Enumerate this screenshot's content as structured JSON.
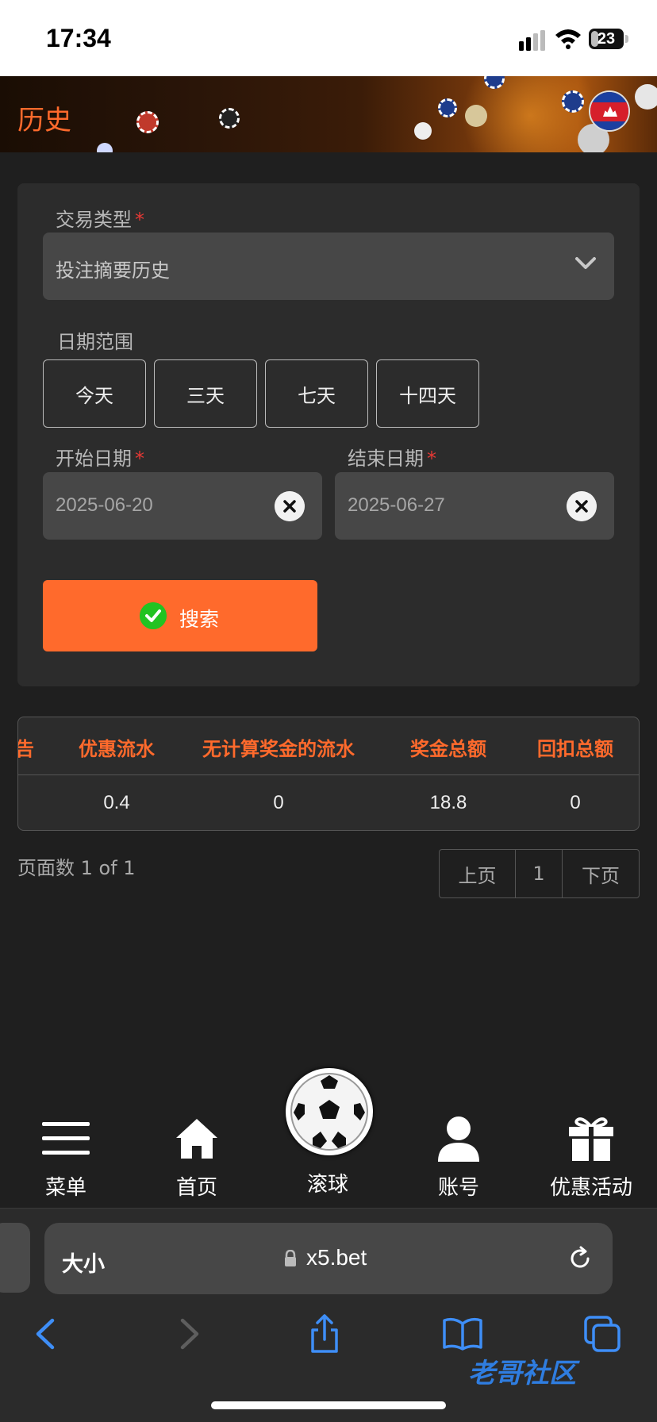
{
  "status_bar": {
    "time": "17:34",
    "battery": "23",
    "battery_level": 0.23
  },
  "header": {
    "title": "历史"
  },
  "form": {
    "transaction_type_label": "交易类型",
    "required_mark": "*",
    "transaction_type_value": "投注摘要历史",
    "date_range_label": "日期范围",
    "range_buttons": [
      "今天",
      "三天",
      "七天",
      "十四天"
    ],
    "start_date_label": "开始日期",
    "start_date_value": "2025-06-20",
    "end_date_label": "结束日期",
    "end_date_value": "2025-06-27",
    "search_label": "搜索"
  },
  "table": {
    "columns": [
      "告",
      "优惠流水",
      "无计算奖金的流水",
      "奖金总额",
      "回扣总额"
    ],
    "rows": [
      [
        "",
        "0.4",
        "0",
        "18.8",
        "0"
      ]
    ]
  },
  "pagination": {
    "summary": "页面数 1 of 1",
    "prev": "上页",
    "page": "1",
    "next": "下页"
  },
  "bottom_nav": {
    "items": [
      "菜单",
      "首页",
      "滚球",
      "账号",
      "优惠活动"
    ]
  },
  "browser": {
    "text_size": "大小",
    "url": "x5.bet"
  },
  "watermark": {
    "text": "老哥社区"
  },
  "colors": {
    "accent": "#ff6a2c",
    "background": "#1f1f1f",
    "panel": "#2c2c2c",
    "required": "#e53935",
    "success": "#22c322"
  }
}
